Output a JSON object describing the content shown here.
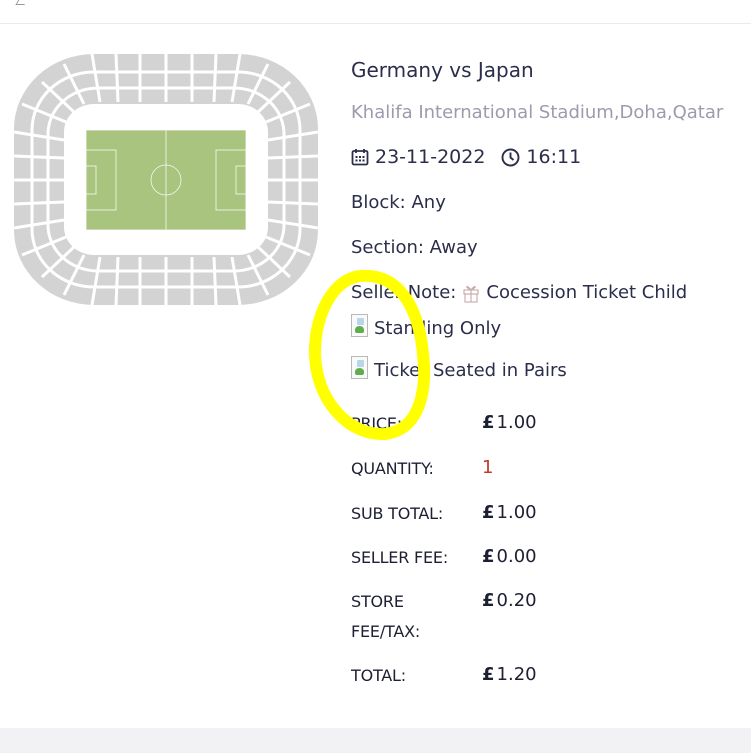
{
  "event": {
    "title": "Germany vs Japan",
    "venue": "Khalifa International Stadium,Doha,Qatar",
    "date": "23-11-2022",
    "time": "16:11",
    "date_icon": "calendar-icon",
    "time_icon": "clock-icon"
  },
  "details": {
    "block": "Block: Any",
    "section": "Section: Away",
    "seller_note_label": "Seller Note:",
    "seller_note_icon": "gift-icon",
    "seller_note_text": "Cocession Ticket Child",
    "features": [
      {
        "icon": "broken-image-icon",
        "text": "Standing Only"
      },
      {
        "icon": "broken-image-icon",
        "text": "Ticket Seated in Pairs"
      }
    ]
  },
  "pricing": {
    "currency_symbol": "£",
    "price_label": "PRICE:",
    "price_value": "1.00",
    "quantity_label": "QUANTITY:",
    "quantity_value": "1",
    "subtotal_label": "SUB TOTAL:",
    "subtotal_value": "1.00",
    "seller_fee_label": "SELLER FEE:",
    "seller_fee_value": "0.00",
    "store_fee_label_line1": "STORE",
    "store_fee_label_line2": "FEE/TAX:",
    "store_fee_value": "0.20",
    "total_label": "TOTAL:",
    "total_value": "1.20"
  },
  "colors": {
    "heading": "#2b2e4a",
    "muted": "#9a9cae",
    "quantity": "#c0392b",
    "pitch": "#a8c47e",
    "seats": "#d3d3d3",
    "highlight": "#ffff00"
  }
}
